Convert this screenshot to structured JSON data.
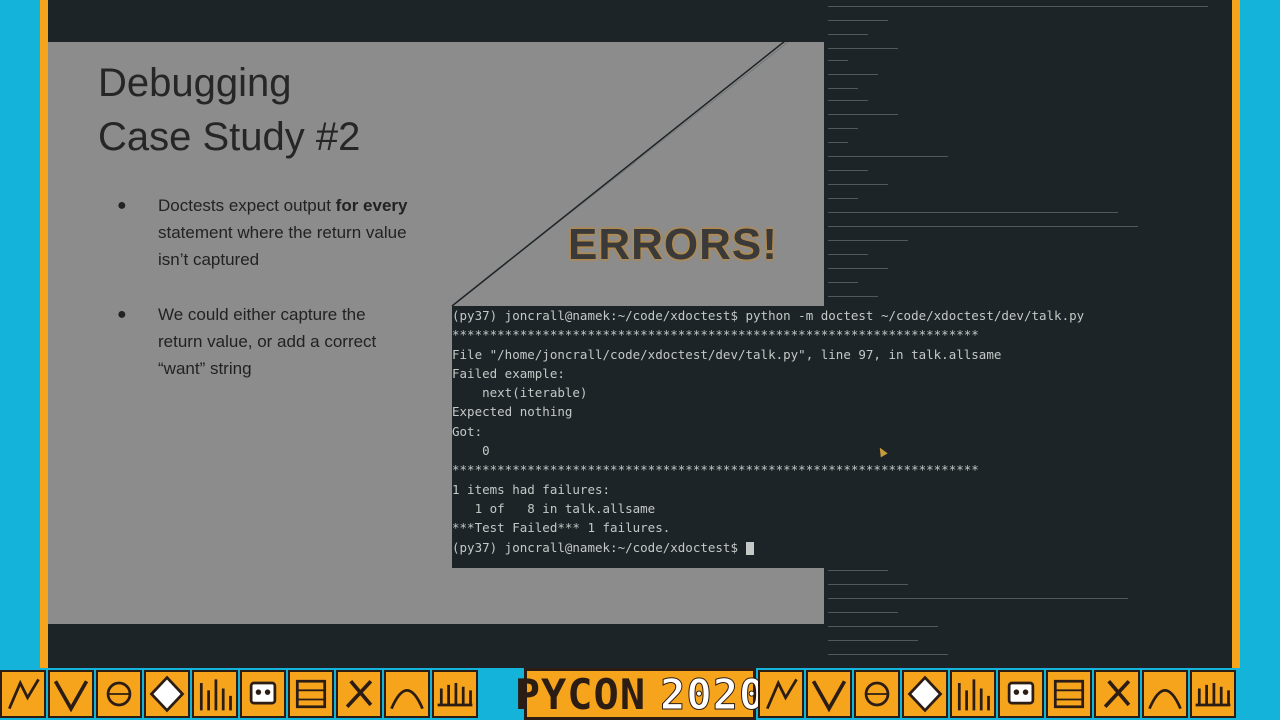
{
  "slide": {
    "title": "Debugging\nCase Study #2",
    "bullets": [
      {
        "pre": "Doctests expect output ",
        "bold": "for every",
        "post": " statement where the return value isn’t captured"
      },
      {
        "pre": "We could either capture the return value, or add a correct “want” string",
        "bold": "",
        "post": ""
      }
    ],
    "overlay": "ERRORS!"
  },
  "terminal": {
    "lines": [
      "(py37) joncrall@namek:~/code/xdoctest$ python -m doctest ~/code/xdoctest/dev/talk.py",
      "**********************************************************************",
      "File \"/home/joncrall/code/xdoctest/dev/talk.py\", line 97, in talk.allsame",
      "Failed example:",
      "    next(iterable)",
      "Expected nothing",
      "Got:",
      "    0",
      "**********************************************************************",
      "1 items had failures:",
      "   1 of   8 in talk.allsame",
      "***Test Failed*** 1 failures."
    ],
    "prompt": "(py37) joncrall@namek:~/code/xdoctest$ "
  },
  "banner": {
    "brand": "PYCON",
    "year": "2020"
  },
  "colors": {
    "accent_orange": "#f7a41d",
    "frame_blue": "#13b3da",
    "terminal_bg": "#1d2428",
    "slide_bg": "#8c8c8c"
  }
}
